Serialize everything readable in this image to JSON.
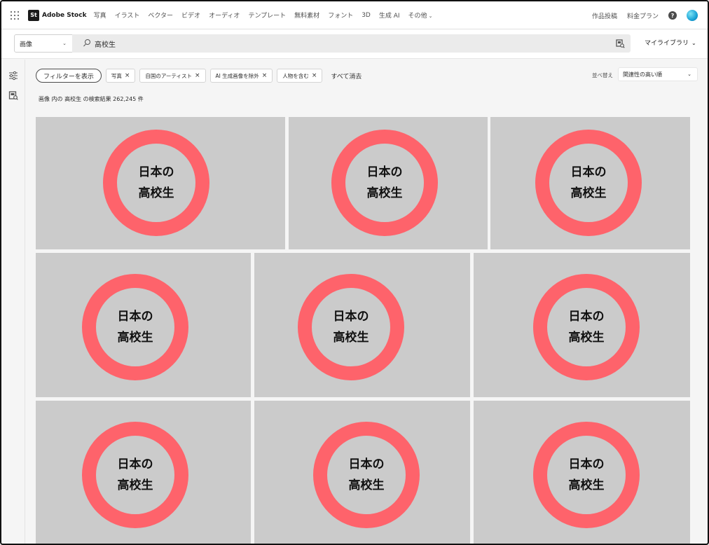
{
  "app": {
    "logo_badge": "St",
    "logo_text": "Adobe Stock"
  },
  "nav": {
    "items": [
      "写真",
      "イラスト",
      "ベクター",
      "ビデオ",
      "オーディオ",
      "テンプレート",
      "無料素材",
      "フォント",
      "3D",
      "生成 AI"
    ],
    "more_label": "その他",
    "contributor_label": "作品投稿",
    "pricing_label": "料金プラン",
    "help_glyph": "?"
  },
  "search": {
    "type_value": "画像",
    "query": "高校生",
    "my_library_label": "マイライブラリ"
  },
  "filters": {
    "show_filters_label": "フィルターを表示",
    "chips": [
      "写真",
      "自国のアーティスト",
      "AI 生成画像を除外",
      "人物を含む"
    ],
    "clear_all_label": "すべて消去"
  },
  "sort": {
    "label": "並べ替え",
    "value": "関連性の高い順"
  },
  "results": {
    "summary": "画像 内の 高校生 の検索結果 262,245 件"
  },
  "tile_text": {
    "line1": "日本の",
    "line2": "高校生"
  },
  "colors": {
    "ring": "#fe636b",
    "tile_bg": "#cbcbcb",
    "page_bg": "#f5f5f5"
  },
  "icons": {
    "apps": "apps-grid-icon",
    "search": "search-icon",
    "visual_search": "visual-search-icon",
    "filter_rail": "sliders-icon",
    "similar_rail": "image-search-icon",
    "help": "help-circle-icon",
    "avatar": "user-avatar"
  }
}
